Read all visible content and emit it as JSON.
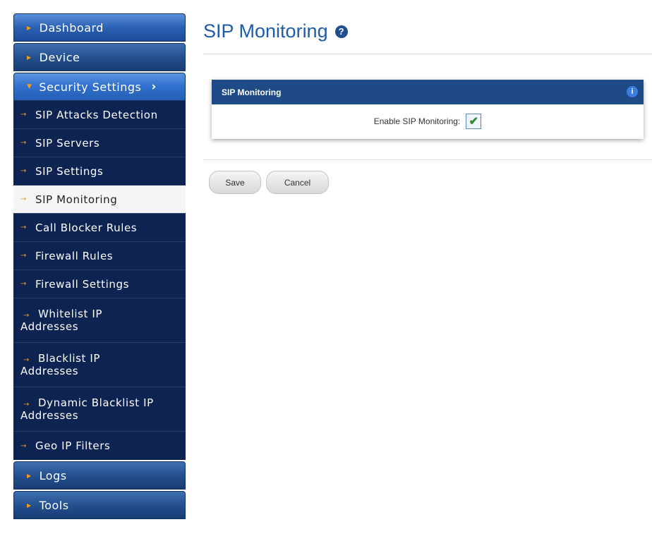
{
  "sidebar": {
    "dashboard": "Dashboard",
    "device": "Device",
    "security": "Security Settings",
    "sub_items": [
      "SIP Attacks Detection",
      "SIP Servers",
      "SIP Settings",
      "SIP Monitoring",
      "Call Blocker Rules",
      "Firewall Rules",
      "Firewall Settings"
    ],
    "whitelist": [
      "Whitelist IP",
      "Addresses"
    ],
    "blacklist": [
      "Blacklist IP",
      "Addresses"
    ],
    "dynamic": [
      "Dynamic Blacklist IP",
      "Addresses"
    ],
    "geo": "Geo IP Filters",
    "logs": "Logs",
    "tools": "Tools"
  },
  "page": {
    "title": "SIP Monitoring"
  },
  "panel": {
    "header": "SIP Monitoring",
    "field_label": "Enable SIP Monitoring:",
    "checked": true
  },
  "buttons": {
    "save": "Save",
    "cancel": "Cancel"
  },
  "colors": {
    "title": "#1f5ba6",
    "panel_header": "#1e4b86",
    "sidebar_sub": "#0d2351",
    "arrow_accent": "#f39c12"
  }
}
